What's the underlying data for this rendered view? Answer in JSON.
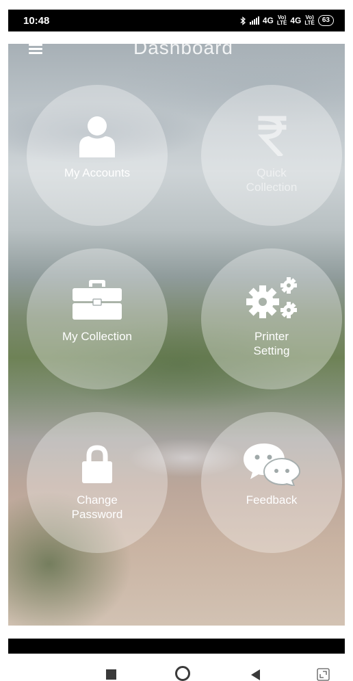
{
  "status_bar": {
    "time": "10:48",
    "bluetooth_icon": "bluetooth-icon",
    "network_1": "4G",
    "network_2": "4G",
    "battery": "63"
  },
  "header": {
    "title": "Dashboard",
    "menu_icon": "hamburger-menu-icon"
  },
  "tiles": [
    {
      "label": "My Accounts",
      "icon": "user-icon"
    },
    {
      "label": "Quick\nCollection",
      "icon": "rupee-icon"
    },
    {
      "label": "My Collection",
      "icon": "briefcase-icon"
    },
    {
      "label": "Printer\nSetting",
      "icon": "gears-icon"
    },
    {
      "label": "Change\nPassword",
      "icon": "lock-icon"
    },
    {
      "label": "Feedback",
      "icon": "chat-bubbles-icon"
    }
  ],
  "nav": {
    "recents_icon": "square-icon",
    "home_icon": "circle-icon",
    "back_icon": "back-triangle-icon",
    "expand_icon": "expand-icon"
  },
  "colors": {
    "status_bar_bg": "#000000",
    "tile_fill": "rgba(255,255,255,0.32)",
    "text": "#ffffff"
  }
}
